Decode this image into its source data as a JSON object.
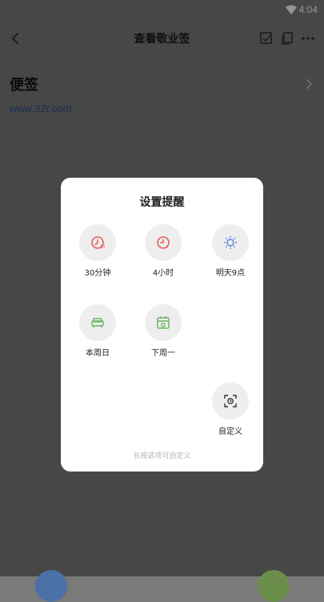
{
  "status_bar": {
    "time": "4:04",
    "wifi_icon": "wifi-icon"
  },
  "app_bar": {
    "title": "查看敬业签"
  },
  "note": {
    "title": "便签",
    "link": "www.32r.com"
  },
  "dialog": {
    "title": "设置提醒",
    "options": [
      {
        "label": "30分钟",
        "icon": "alarm-30min-icon",
        "color": "#e26060"
      },
      {
        "label": "4小时",
        "icon": "alarm-4h-icon",
        "color": "#e26060"
      },
      {
        "label": "明天9点",
        "icon": "sun-icon",
        "color": "#5b86e0"
      },
      {
        "label": "本周日",
        "icon": "sofa-icon",
        "color": "#6ab564"
      },
      {
        "label": "下周一",
        "icon": "calendar-icon",
        "color": "#6ab564"
      },
      {
        "label": "自定义",
        "icon": "custom-time-icon",
        "color": "#333333"
      }
    ],
    "hint": "长按选项可自定义"
  }
}
